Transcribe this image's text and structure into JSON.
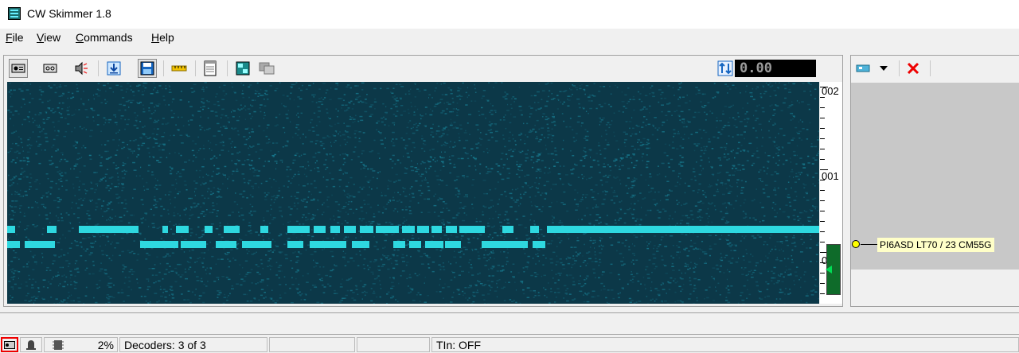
{
  "window": {
    "title": "CW Skimmer 1.8"
  },
  "menu": {
    "file": "File",
    "view": "View",
    "commands": "Commands",
    "help": "Help"
  },
  "toolbar": {
    "icons": [
      "radio-icon",
      "tape-icon",
      "speaker-icon",
      "download-arrow-icon",
      "floppy-icon",
      "ruler-icon",
      "notepad-icon",
      "tile-icon",
      "window-icon"
    ],
    "offset_value": "0.00"
  },
  "waterfall": {
    "scale_labels": [
      "002",
      "001",
      "000"
    ],
    "colors": {
      "background": "#0c3848",
      "signal": "#2ed8e0",
      "noise": "#1a8aa0"
    }
  },
  "spots": [
    {
      "label": "PI6ASD LT70 / 23 CM55G"
    }
  ],
  "status": {
    "cpu": "2%",
    "decoders": "Decoders: 3 of 3",
    "tln": "TIn: OFF"
  }
}
